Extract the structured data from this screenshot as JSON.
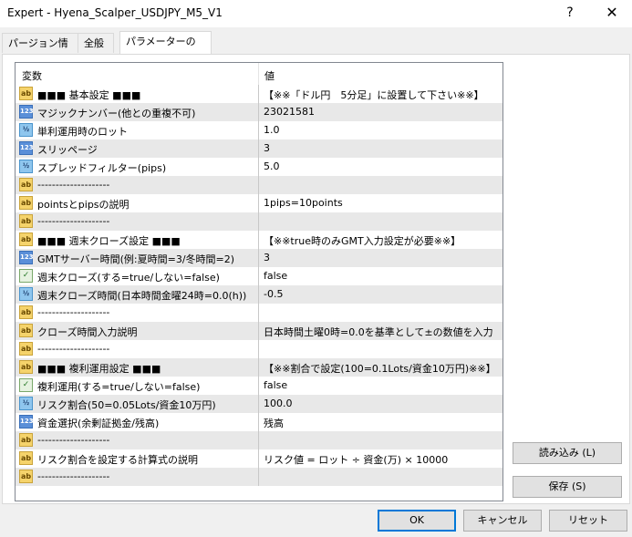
{
  "window": {
    "title": "Expert - Hyena_Scalper_USDJPY_M5_V1",
    "help": "?",
    "close": "✕"
  },
  "tabs": [
    {
      "label": "パージョン情報"
    },
    {
      "label": "全般"
    },
    {
      "label": "パラメーターの入力",
      "active": true
    }
  ],
  "grid": {
    "header_name": "変数",
    "header_value": "値",
    "rows": [
      {
        "icon": "ab",
        "name": "■■■ 基本設定 ■■■",
        "value": "【※※「ドル円　5分足」に設置して下さい※※】"
      },
      {
        "icon": "123",
        "name": "マジックナンバー(他との重複不可)",
        "value": "23021581"
      },
      {
        "icon": "v2",
        "name": "単利運用時のロット",
        "value": "1.0"
      },
      {
        "icon": "123",
        "name": "スリッページ",
        "value": "3"
      },
      {
        "icon": "v2",
        "name": "スプレッドフィルター(pips)",
        "value": "5.0"
      },
      {
        "icon": "ab",
        "name": "--------------------",
        "value": ""
      },
      {
        "icon": "ab",
        "name": "pointsとpipsの説明",
        "value": "1pips=10points"
      },
      {
        "icon": "ab",
        "name": "--------------------",
        "value": ""
      },
      {
        "icon": "ab",
        "name": "■■■ 週末クローズ設定 ■■■",
        "value": "【※※true時のみGMT入力設定が必要※※】"
      },
      {
        "icon": "123",
        "name": "GMTサーバー時間(例:夏時間=3/冬時間=2)",
        "value": "3"
      },
      {
        "icon": "bool",
        "name": "週末クローズ(する=true/しない=false)",
        "value": "false"
      },
      {
        "icon": "v2",
        "name": "週末クローズ時間(日本時間金曜24時=0.0(h))",
        "value": "-0.5"
      },
      {
        "icon": "ab",
        "name": "--------------------",
        "value": ""
      },
      {
        "icon": "ab",
        "name": "クローズ時間入力説明",
        "value": "日本時間土曜0時=0.0を基準として±の数値を入力"
      },
      {
        "icon": "ab",
        "name": "--------------------",
        "value": ""
      },
      {
        "icon": "ab",
        "name": "■■■ 複利運用設定 ■■■",
        "value": "【※※割合で設定(100=0.1Lots/資金10万円)※※】"
      },
      {
        "icon": "bool",
        "name": "複利運用(する=true/しない=false)",
        "value": "false"
      },
      {
        "icon": "v2",
        "name": "リスク割合(50=0.05Lots/資金10万円)",
        "value": "100.0"
      },
      {
        "icon": "123",
        "name": "資金選択(余剰証拠金/残高)",
        "value": "残高"
      },
      {
        "icon": "ab",
        "name": "--------------------",
        "value": ""
      },
      {
        "icon": "ab",
        "name": "リスク割合を設定する計算式の説明",
        "value": "リスク値 = ロット ÷ 資金(万) × 10000"
      },
      {
        "icon": "ab",
        "name": "--------------------",
        "value": ""
      }
    ]
  },
  "buttons": {
    "load": "読み込み (L)",
    "save": "保存 (S)",
    "ok": "OK",
    "cancel": "キャンセル",
    "reset": "リセット"
  },
  "icon_labels": {
    "ab": "ab",
    "123": "123",
    "v2": "½",
    "bool": "✓"
  }
}
